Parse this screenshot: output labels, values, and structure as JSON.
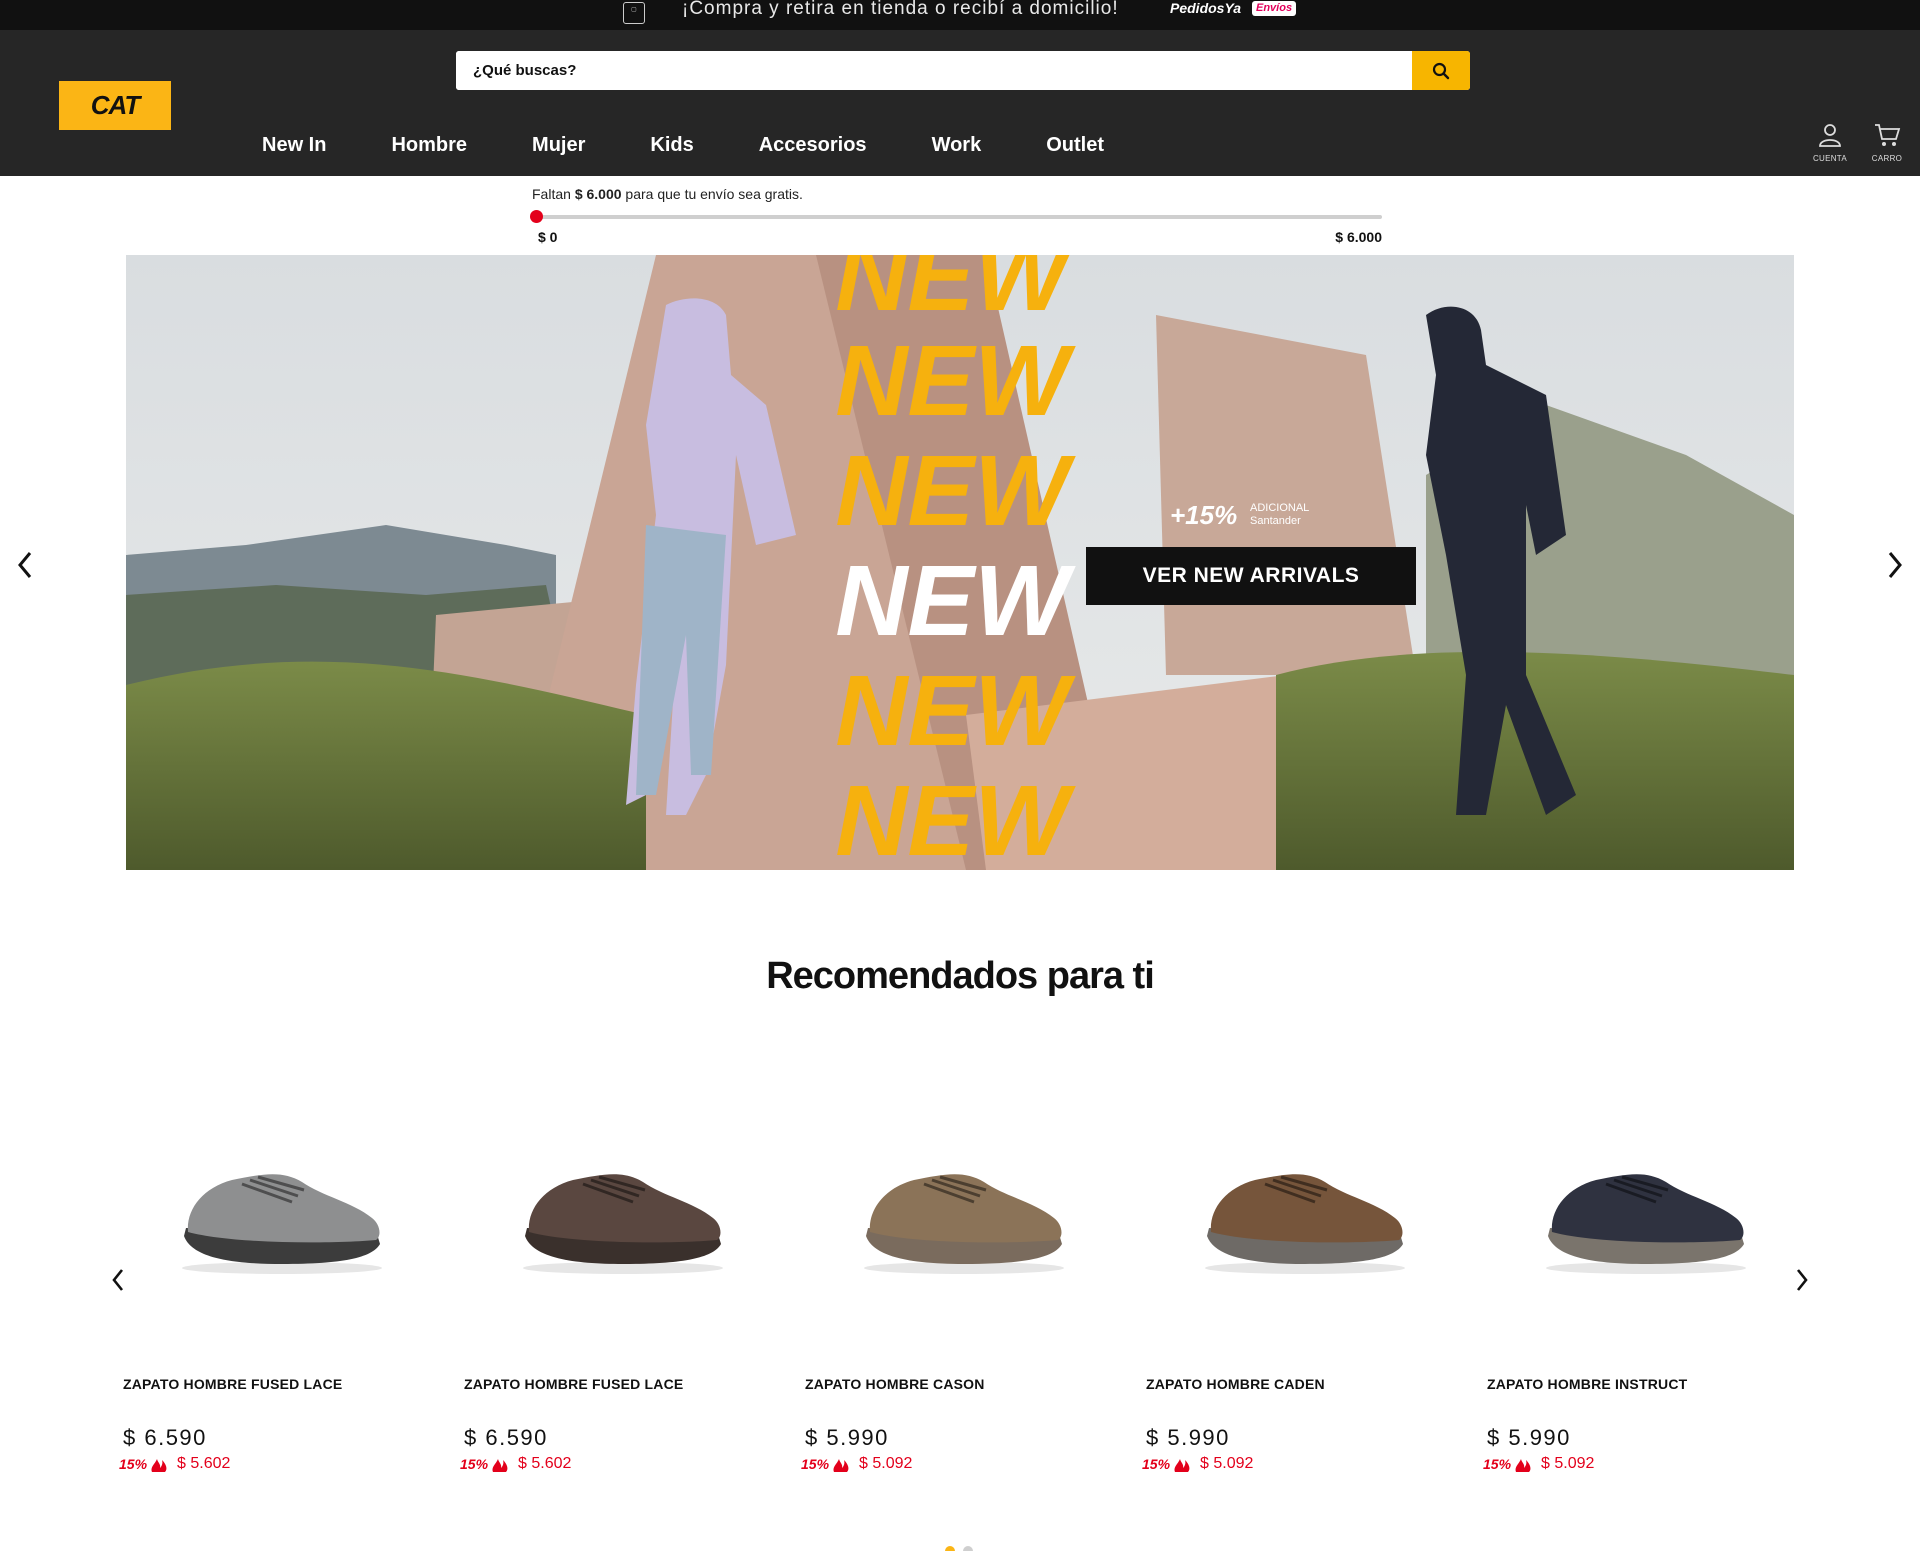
{
  "promo_bar": {
    "store_icon_label": "Click\nCollect",
    "message": "¡Compra y retira en tienda o recibí a domicilio!",
    "partner": "PedidosYa",
    "partner_tag": "Envíos"
  },
  "header": {
    "logo_text": "CAT",
    "search": {
      "placeholder": "¿Qué buscas?",
      "value": ""
    },
    "nav": [
      "New In",
      "Hombre",
      "Mujer",
      "Kids",
      "Accesorios",
      "Work",
      "Outlet"
    ],
    "account_label": "CUENTA",
    "cart_label": "CARRO"
  },
  "shipping": {
    "prefix": "Faltan",
    "amount": "$ 6.000",
    "suffix": "para que tu envío sea gratis.",
    "min_label": "$ 0",
    "max_label": "$ 6.000",
    "progress_fraction": 0
  },
  "hero": {
    "headline_words": [
      "NEW",
      "NEW",
      "NEW",
      "NEW",
      "NEW",
      "NEW"
    ],
    "promo_percent": "+15%",
    "promo_line1": "ADICIONAL",
    "promo_line2": "Santander",
    "cta": "VER NEW ARRIVALS"
  },
  "recommended": {
    "title": "Recomendados para ti",
    "products": [
      {
        "name": "ZAPATO HOMBRE FUSED LACE",
        "price": "$ 6.590",
        "discount_pct": "15%",
        "discount_price": "$ 5.602",
        "color": "#8e8f90",
        "sole": "#3c3c3c"
      },
      {
        "name": "ZAPATO HOMBRE FUSED LACE",
        "price": "$ 6.590",
        "discount_pct": "15%",
        "discount_price": "$ 5.602",
        "color": "#5a4740",
        "sole": "#3a302c"
      },
      {
        "name": "ZAPATO HOMBRE CASON",
        "price": "$ 5.990",
        "discount_pct": "15%",
        "discount_price": "$ 5.092",
        "color": "#8b7358",
        "sole": "#7a6b5d"
      },
      {
        "name": "ZAPATO HOMBRE CADEN",
        "price": "$ 5.990",
        "discount_pct": "15%",
        "discount_price": "$ 5.092",
        "color": "#76553b",
        "sole": "#6e6a66"
      },
      {
        "name": "ZAPATO HOMBRE INSTRUCT",
        "price": "$ 5.990",
        "discount_pct": "15%",
        "discount_price": "$ 5.092",
        "color": "#2f3240",
        "sole": "#7a746c"
      }
    ],
    "active_page": 1,
    "page_count": 2
  },
  "colors": {
    "brand_yellow": "#fbb515",
    "header_bg": "#262626",
    "sale_red": "#e3001b"
  }
}
